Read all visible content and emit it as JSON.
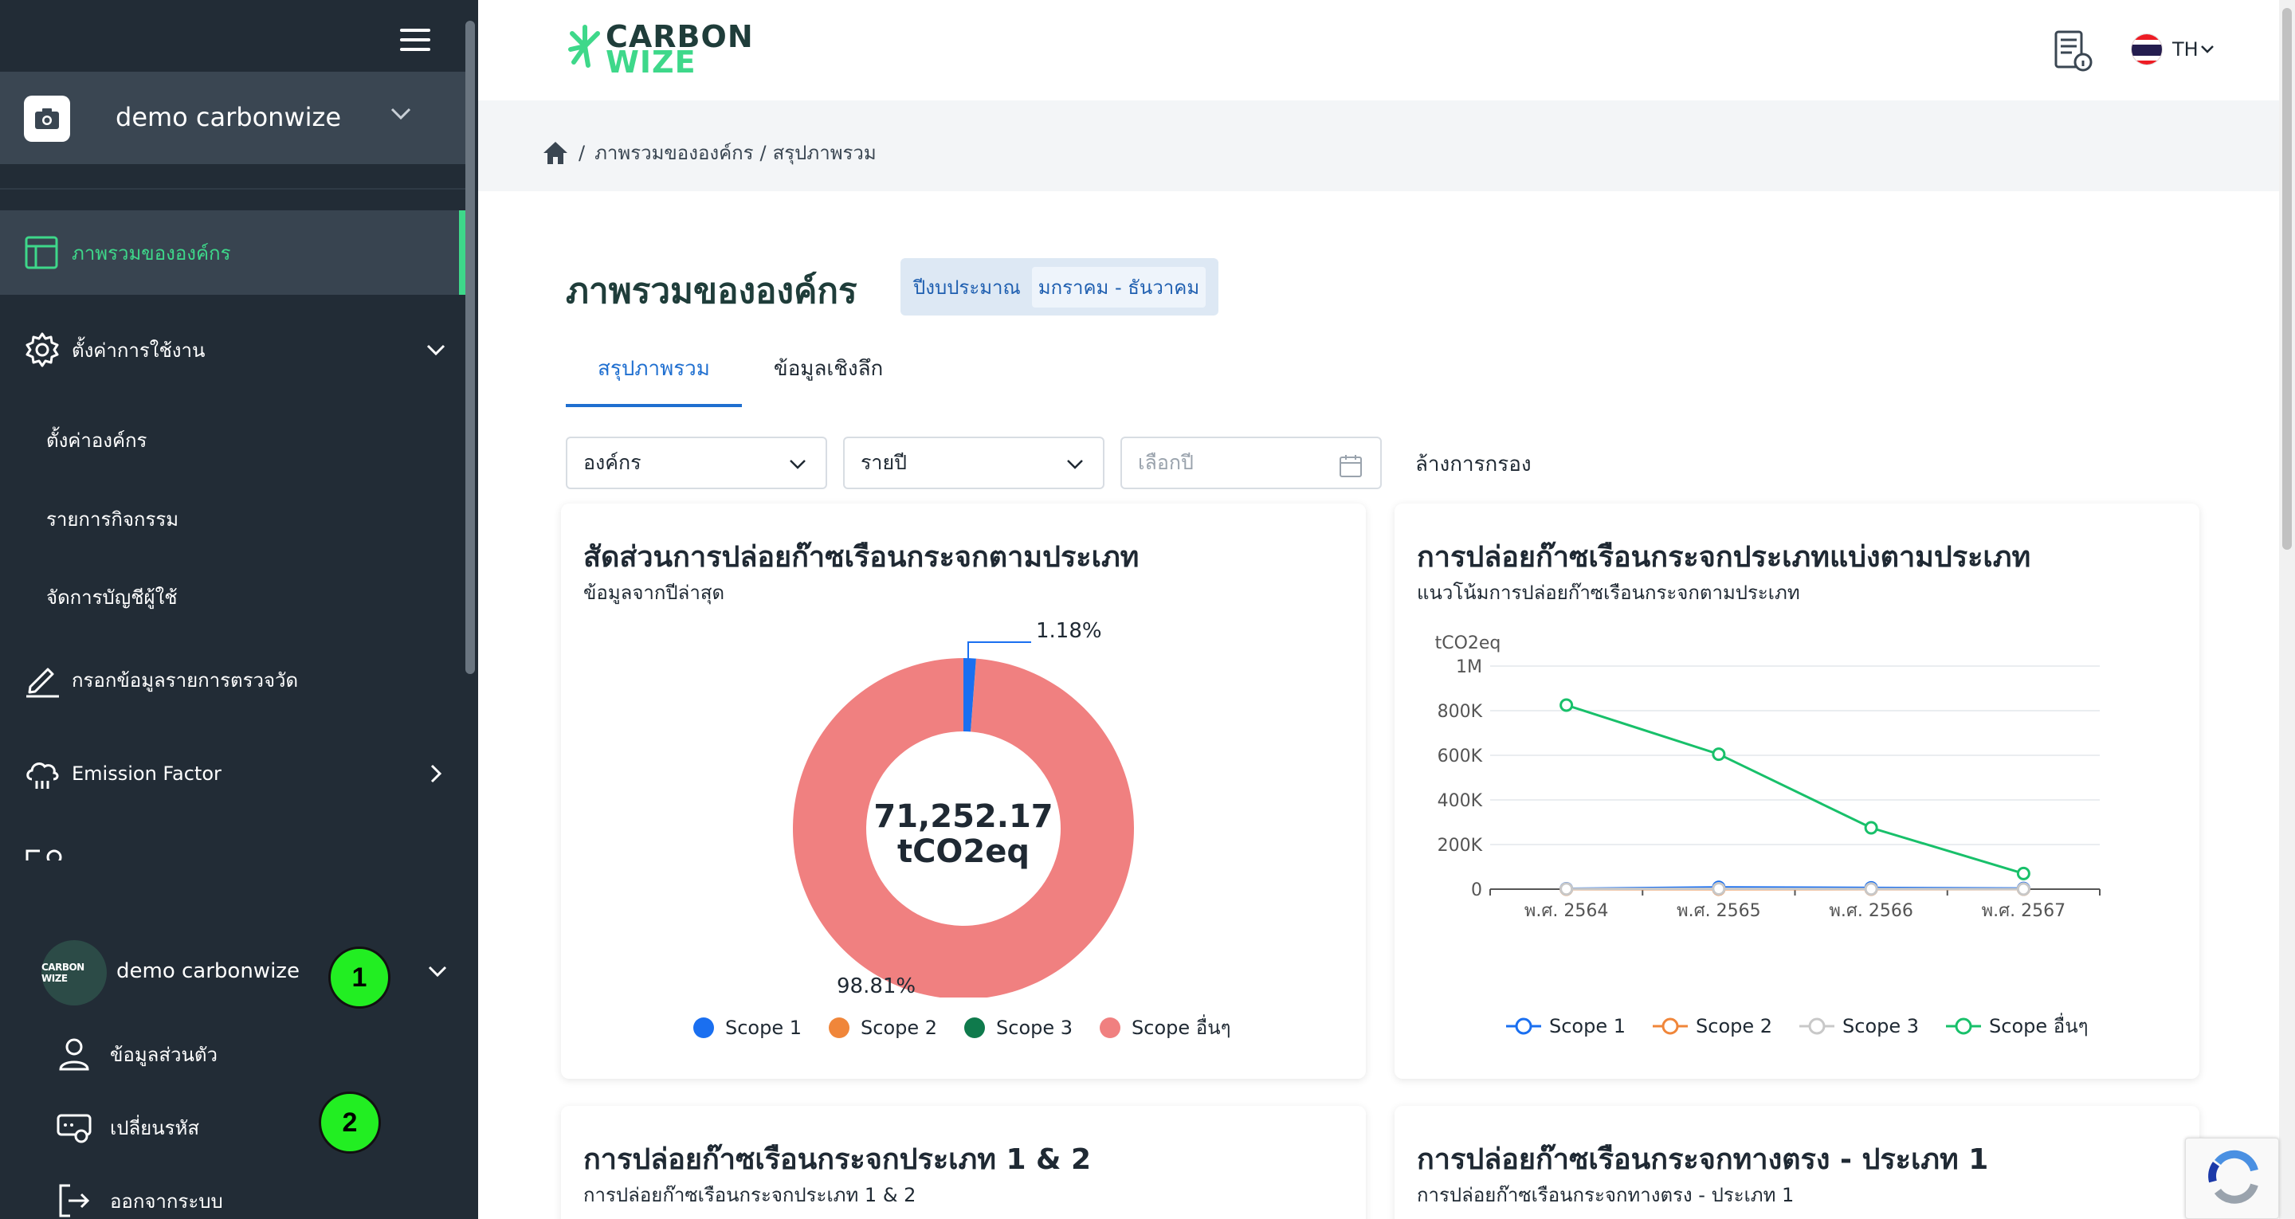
{
  "sidebar": {
    "org_name": "demo carbonwize",
    "nav": [
      {
        "label": "ภาพรวมขององค์กร"
      },
      {
        "label": "ตั้งค่าการใช้งาน"
      },
      {
        "label": "ตั้งค่าองค์กร"
      },
      {
        "label": "รายการกิจกรรม"
      },
      {
        "label": "จัดการบัญชีผู้ใช้"
      },
      {
        "label": "กรอกข้อมูลรายการตรวจวัด"
      },
      {
        "label": "Emission Factor"
      }
    ],
    "user": {
      "avatar_text": "CARBON WIZE",
      "name": "demo carbonwize",
      "menu": [
        {
          "label": "ข้อมูลส่วนตัว"
        },
        {
          "label": "เปลี่ยนรหัส"
        },
        {
          "label": "ออกจากระบบ"
        }
      ]
    },
    "badges": [
      "1",
      "2"
    ]
  },
  "topbar": {
    "logo_line1": "CARBON",
    "logo_line2": "WIZE",
    "language": "TH"
  },
  "breadcrumb": {
    "items": [
      "/",
      "ภาพรวมขององค์กร",
      "/",
      "สรุปภาพรวม"
    ]
  },
  "main": {
    "title": "ภาพรวมขององค์กร",
    "fiscal_label": "ปีงบประมาณ",
    "fiscal_value": "มกราคม - ธันวาคม",
    "tabs": [
      {
        "label": "สรุปภาพรวม"
      },
      {
        "label": "ข้อมูลเชิงลึก"
      }
    ],
    "filters": {
      "org": "องค์กร",
      "period": "รายปี",
      "year_placeholder": "เลือกปี",
      "clear": "ล้างการกรอง"
    }
  },
  "cards": {
    "donut": {
      "title": "สัดส่วนการปล่อยก๊าซเรือนกระจกตามประเภท",
      "subtitle": "ข้อมูลจากปีล่าสุด"
    },
    "line": {
      "title": "การปล่อยก๊าซเรือนกระจกประเภทแบ่งตามประเภท",
      "subtitle": "แนวโน้มการปล่อยก๊าซเรือนกระจกตามประเภท"
    },
    "scope12": {
      "title": "การปล่อยก๊าซเรือนกระจกประเภท 1 & 2",
      "subtitle": "การปล่อยก๊าซเรือนกระจกประเภท 1 & 2"
    },
    "direct": {
      "title": "การปล่อยก๊าซเรือนกระจกทางตรง - ประเภท 1",
      "subtitle": "การปล่อยก๊าซเรือนกระจกทางตรง - ประเภท 1"
    }
  },
  "chart_data": [
    {
      "type": "pie",
      "center_value": "71,252.17",
      "center_unit": "tCO2eq",
      "slices": [
        {
          "name": "Scope 1",
          "value": 1.18,
          "label": "1.18%",
          "color": "#1a6ff0"
        },
        {
          "name": "Scope 2",
          "value": 0,
          "label": "",
          "color": "#f0863a"
        },
        {
          "name": "Scope 3",
          "value": 0.01,
          "label": "",
          "color": "#0f7a4c"
        },
        {
          "name": "Scope อื่นๆ",
          "value": 98.81,
          "label": "98.81%",
          "color": "#f08080"
        }
      ],
      "legend": [
        "Scope 1",
        "Scope 2",
        "Scope 3",
        "Scope อื่นๆ"
      ]
    },
    {
      "type": "line",
      "ylabel": "tCO2eq",
      "ylim": [
        0,
        1000000
      ],
      "yticks": [
        "0",
        "200K",
        "400K",
        "600K",
        "800K",
        "1M"
      ],
      "categories": [
        "พ.ศ. 2564",
        "พ.ศ. 2565",
        "พ.ศ. 2566",
        "พ.ศ. 2567"
      ],
      "series": [
        {
          "name": "Scope 1",
          "color": "#1a6ff0",
          "values": [
            2000,
            8000,
            6000,
            3000
          ]
        },
        {
          "name": "Scope 2",
          "color": "#f0863a",
          "values": [
            0,
            0,
            0,
            0
          ]
        },
        {
          "name": "Scope 3",
          "color": "#c8c8c8",
          "values": [
            1000,
            2000,
            1000,
            500
          ]
        },
        {
          "name": "Scope อื่นๆ",
          "color": "#18c06a",
          "values": [
            825000,
            605000,
            275000,
            70000
          ]
        }
      ],
      "grid": true,
      "legend_position": "bottom"
    }
  ]
}
